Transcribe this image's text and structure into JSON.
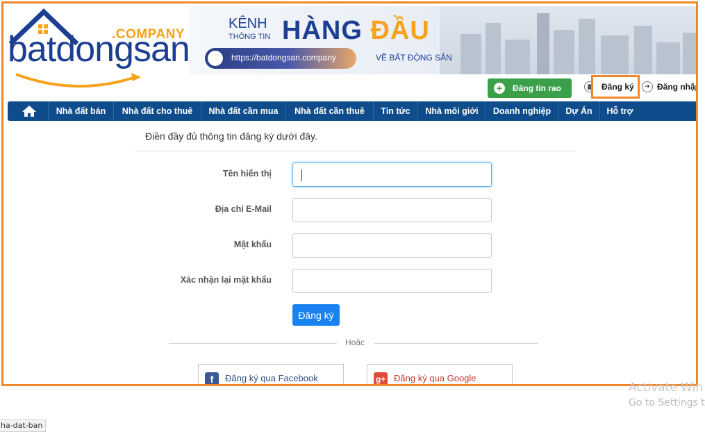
{
  "logo": {
    "word": "batdongsan",
    "suffix": ".COMPANY"
  },
  "banner": {
    "kenh": "KÊNH",
    "thong_tin": "THÔNG TIN",
    "hang": "HÀNG",
    "dau": "ĐẦU",
    "url": "https://batdongsan.company",
    "subtitle": "VỀ BẤT ĐỘNG SẢN"
  },
  "header": {
    "post_label": "Đăng tin rao",
    "register_label": "Đăng ký",
    "login_label": "Đăng nhập"
  },
  "nav": {
    "items": [
      {
        "label": "Nhà đất bán"
      },
      {
        "label": "Nhà đất cho thuê"
      },
      {
        "label": "Nhà đất cần mua"
      },
      {
        "label": "Nhà đất cần thuê"
      },
      {
        "label": "Tin tức"
      },
      {
        "label": "Nhà môi giới"
      },
      {
        "label": "Doanh nghiệp"
      },
      {
        "label": "Dự Án"
      },
      {
        "label": "Hỗ trợ"
      }
    ]
  },
  "form": {
    "intro": "Điền đầy đủ thông tin đăng ký dưới đây.",
    "display_name_label": "Tên hiển thị",
    "display_name_value": "",
    "email_label": "Địa chỉ E-Mail",
    "email_value": "",
    "password_label": "Mật khẩu",
    "password_value": "",
    "confirm_label": "Xác nhận lại mật khẩu",
    "confirm_value": "",
    "submit_label": "Đăng ký",
    "or_text": "Hoặc",
    "facebook_label": "Đăng ký qua Facebook",
    "google_label": "Đăng ký qua Google"
  },
  "watermark": {
    "line1": "Activate Win",
    "line2": "Go to Settings to"
  },
  "status_url": "ha-dat-ban",
  "colors": {
    "brand_blue": "#1d3f92",
    "brand_orange": "#f6a21b",
    "nav_bg": "#0f4c8c",
    "post_green": "#3aa04a",
    "submit_blue": "#1a82f0",
    "highlight": "#f0872a",
    "facebook": "#3b5998",
    "google": "#dd4b39"
  },
  "icons": [
    "house-logo-icon",
    "home-icon",
    "plus-circle-icon",
    "user-icon",
    "login-icon",
    "globe-icon",
    "facebook-icon",
    "google-plus-icon"
  ]
}
